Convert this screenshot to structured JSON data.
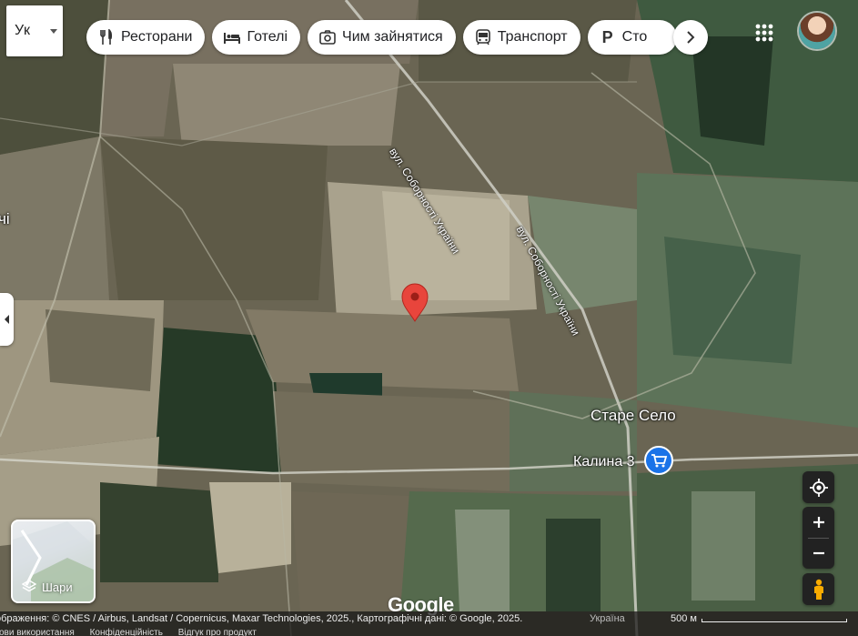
{
  "language_selector": {
    "code": "Ук"
  },
  "category_chips": [
    {
      "label": "Ресторани",
      "icon": "restaurant-icon"
    },
    {
      "label": "Готелі",
      "icon": "hotel-icon"
    },
    {
      "label": "Чим зайнятися",
      "icon": "camera-icon"
    },
    {
      "label": "Транспорт",
      "icon": "transit-icon"
    },
    {
      "label": "Сто",
      "icon": "parking-icon"
    }
  ],
  "map": {
    "type": "satellite",
    "labels": {
      "road_1": "вул. Соборності України",
      "road_2": "вул. Соборності України",
      "village": "Старе Село",
      "store": "Калина 3",
      "edge_label": "чі"
    },
    "colors": {
      "pin": "#e8453c",
      "store_pin": "#1a73e8"
    }
  },
  "layers_button": {
    "label": "Шари"
  },
  "footer": {
    "attribution": "ображення: © CNES / Airbus, Landsat / Copernicus, Maxar Technologies, 2025., Картографічні дані: © Google, 2025.",
    "country": "Україна",
    "scale_label": "500 м",
    "links": [
      "ови використання",
      "Конфіденційність",
      "Відгук про продукт"
    ]
  },
  "logo_text": "Google"
}
